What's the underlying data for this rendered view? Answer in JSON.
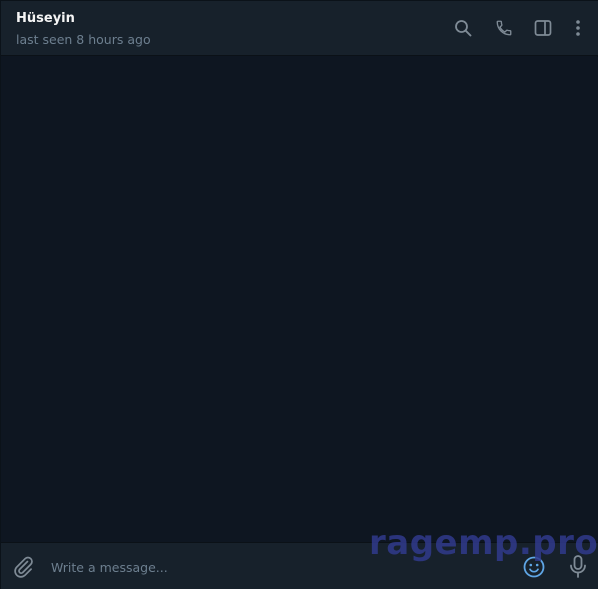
{
  "chat_header": {
    "peer_name": "Hüseyin",
    "status": "last seen 8 hours ago"
  },
  "toolbar_icons": [
    "search-icon",
    "phone-icon",
    "sidebar-toggle-icon",
    "more-vertical-icon"
  ],
  "composer": {
    "placeholder": "Write a message...",
    "icons": [
      "paperclip-icon",
      "emoji-icon",
      "microphone-icon"
    ]
  },
  "watermark": "ragemp.pro",
  "colors": {
    "header_bg": "#17212b",
    "chat_bg": "#0e1621",
    "icon": "#7f8b96",
    "accent": "#5fa6e6",
    "status_text": "#6d7f8f"
  }
}
